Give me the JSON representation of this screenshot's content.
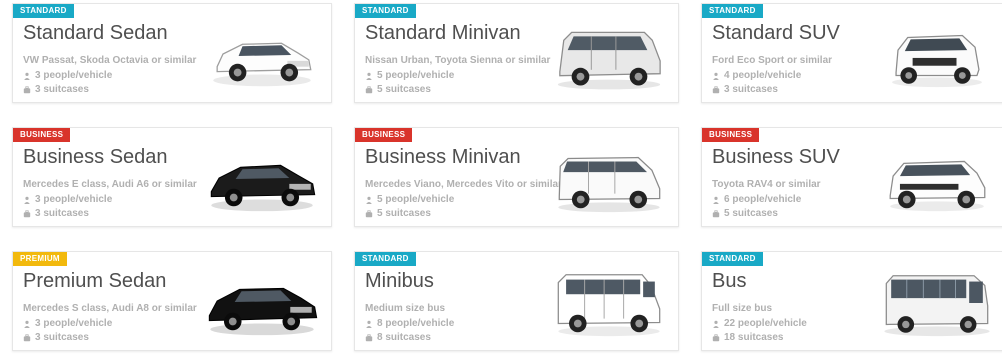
{
  "cards": [
    {
      "badge": "STANDARD",
      "badge_kind": "standard",
      "title": "Standard Sedan",
      "similar": "VW Passat, Skoda Octavia or similar",
      "people": "3 people/vehicle",
      "suitcases": "3 suitcases",
      "vehicle_icon": "sedan-icon",
      "vehicle_color": "#ffffff"
    },
    {
      "badge": "STANDARD",
      "badge_kind": "standard",
      "title": "Standard Minivan",
      "similar": "Nissan Urban, Toyota Sienna or similar",
      "people": "5 people/vehicle",
      "suitcases": "5 suitcases",
      "vehicle_icon": "minivan-icon",
      "vehicle_color": "#e8e8e8"
    },
    {
      "badge": "STANDARD",
      "badge_kind": "standard",
      "title": "Standard SUV",
      "similar": "Ford Eco Sport or similar",
      "people": "4 people/vehicle",
      "suitcases": "3 suitcases",
      "vehicle_icon": "suv-icon",
      "vehicle_color": "#ffffff"
    },
    {
      "badge": "BUSINESS",
      "badge_kind": "business",
      "title": "Business Sedan",
      "similar": "Mercedes E class, Audi A6 or similar",
      "people": "3 people/vehicle",
      "suitcases": "3 suitcases",
      "vehicle_icon": "sedan-icon",
      "vehicle_color": "#1b1b1b"
    },
    {
      "badge": "BUSINESS",
      "badge_kind": "business",
      "title": "Business Minivan",
      "similar": "Mercedes Viano, Mercedes Vito or similar",
      "people": "5 people/vehicle",
      "suitcases": "5 suitcases",
      "vehicle_icon": "van-icon",
      "vehicle_color": "#ffffff"
    },
    {
      "badge": "BUSINESS",
      "badge_kind": "business",
      "title": "Business SUV",
      "similar": "Toyota RAV4 or similar",
      "people": "6 people/vehicle",
      "suitcases": "5 suitcases",
      "vehicle_icon": "suv-icon",
      "vehicle_color": "#ffffff"
    },
    {
      "badge": "PREMIUM",
      "badge_kind": "premium",
      "title": "Premium Sedan",
      "similar": "Mercedes S class, Audi A8 or similar",
      "people": "3 people/vehicle",
      "suitcases": "3 suitcases",
      "vehicle_icon": "sedan-icon",
      "vehicle_color": "#111111"
    },
    {
      "badge": "STANDARD",
      "badge_kind": "standard",
      "title": "Minibus",
      "similar": "Medium size bus",
      "people": "8 people/vehicle",
      "suitcases": "8 suitcases",
      "vehicle_icon": "minibus-icon",
      "vehicle_color": "#ffffff"
    },
    {
      "badge": "STANDARD",
      "badge_kind": "standard",
      "title": "Bus",
      "similar": "Full size bus",
      "people": "22 people/vehicle",
      "suitcases": "18 suitcases",
      "vehicle_icon": "bus-icon",
      "vehicle_color": "#f3f3f3"
    }
  ]
}
